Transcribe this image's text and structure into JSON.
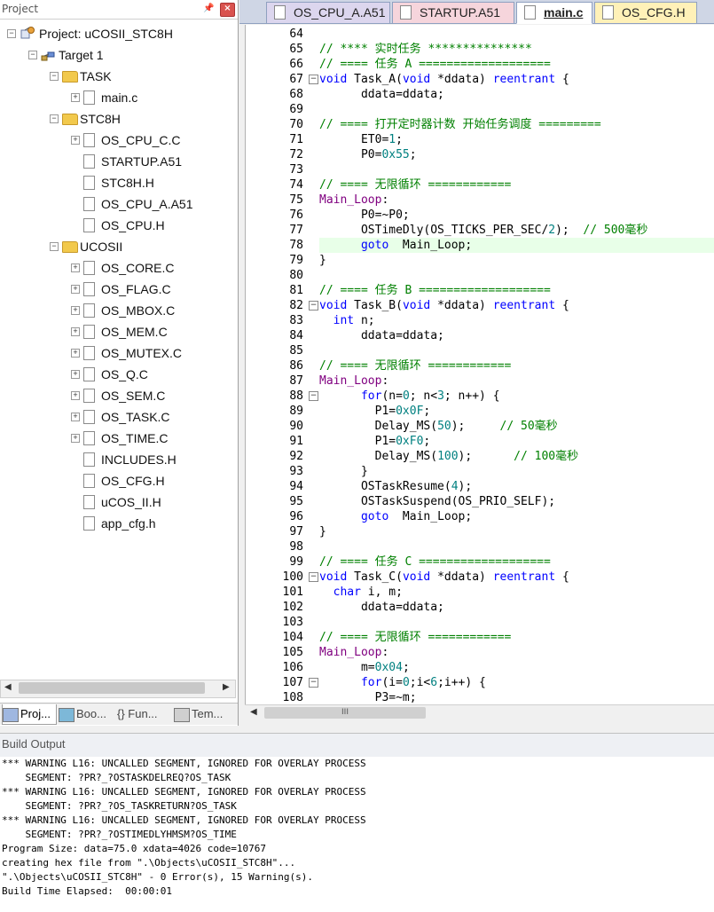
{
  "project_pane": {
    "title": "Project",
    "tree": [
      {
        "label": "Project: uCOSII_STC8H",
        "level": 0,
        "type": "project",
        "expander": "−"
      },
      {
        "label": "Target 1",
        "level": 1,
        "type": "target",
        "expander": "−"
      },
      {
        "label": "TASK",
        "level": 2,
        "type": "folder",
        "expander": "−"
      },
      {
        "label": "main.c",
        "level": 3,
        "type": "file",
        "expander": "+"
      },
      {
        "label": "STC8H",
        "level": 2,
        "type": "folder",
        "expander": "−"
      },
      {
        "label": "OS_CPU_C.C",
        "level": 3,
        "type": "file",
        "expander": "+"
      },
      {
        "label": "STARTUP.A51",
        "level": 3,
        "type": "file",
        "expander": ""
      },
      {
        "label": "STC8H.H",
        "level": 3,
        "type": "file",
        "expander": ""
      },
      {
        "label": "OS_CPU_A.A51",
        "level": 3,
        "type": "file",
        "expander": ""
      },
      {
        "label": "OS_CPU.H",
        "level": 3,
        "type": "file",
        "expander": ""
      },
      {
        "label": "UCOSII",
        "level": 2,
        "type": "folder",
        "expander": "−"
      },
      {
        "label": "OS_CORE.C",
        "level": 3,
        "type": "file",
        "expander": "+"
      },
      {
        "label": "OS_FLAG.C",
        "level": 3,
        "type": "file",
        "expander": "+"
      },
      {
        "label": "OS_MBOX.C",
        "level": 3,
        "type": "file",
        "expander": "+"
      },
      {
        "label": "OS_MEM.C",
        "level": 3,
        "type": "file",
        "expander": "+"
      },
      {
        "label": "OS_MUTEX.C",
        "level": 3,
        "type": "file",
        "expander": "+"
      },
      {
        "label": "OS_Q.C",
        "level": 3,
        "type": "file",
        "expander": "+"
      },
      {
        "label": "OS_SEM.C",
        "level": 3,
        "type": "file",
        "expander": "+"
      },
      {
        "label": "OS_TASK.C",
        "level": 3,
        "type": "file",
        "expander": "+"
      },
      {
        "label": "OS_TIME.C",
        "level": 3,
        "type": "file",
        "expander": "+"
      },
      {
        "label": "INCLUDES.H",
        "level": 3,
        "type": "file",
        "expander": ""
      },
      {
        "label": "OS_CFG.H",
        "level": 3,
        "type": "file",
        "expander": ""
      },
      {
        "label": "uCOS_II.H",
        "level": 3,
        "type": "file",
        "expander": ""
      },
      {
        "label": "app_cfg.h",
        "level": 3,
        "type": "file",
        "expander": ""
      }
    ],
    "tabs": [
      {
        "label": "Proj...",
        "active": true
      },
      {
        "label": "Boo...",
        "active": false
      },
      {
        "label": "{} Fun...",
        "active": false
      },
      {
        "label": "Tem...",
        "active": false
      }
    ]
  },
  "editor": {
    "tabs": [
      {
        "label": "OS_CPU_A.A51",
        "active": false,
        "color": "#dcd6ee"
      },
      {
        "label": "STARTUP.A51",
        "active": false,
        "color": "#f6d5dc"
      },
      {
        "label": "main.c",
        "active": true,
        "color": "#ffffff"
      },
      {
        "label": "OS_CFG.H",
        "active": false,
        "color": "#fff1b8"
      }
    ],
    "highlight_line": 78,
    "lines": [
      {
        "n": "64",
        "text": ""
      },
      {
        "n": "65",
        "text": "// **** 实时任务 ***************"
      },
      {
        "n": "66",
        "text": "// ==== 任务 A ==================="
      },
      {
        "n": "67",
        "text": "void Task_A(void *ddata) reentrant {",
        "fold": "−"
      },
      {
        "n": "68",
        "text": "      ddata=ddata;"
      },
      {
        "n": "69",
        "text": ""
      },
      {
        "n": "70",
        "text": "// ==== 打开定时器计数 开始任务调度 ========="
      },
      {
        "n": "71",
        "text": "      ET0=1;"
      },
      {
        "n": "72",
        "text": "      P0=0x55;"
      },
      {
        "n": "73",
        "text": ""
      },
      {
        "n": "74",
        "text": "// ==== 无限循环 ============"
      },
      {
        "n": "75",
        "text": "Main_Loop:"
      },
      {
        "n": "76",
        "text": "      P0=~P0;"
      },
      {
        "n": "77",
        "text": "      OSTimeDly(OS_TICKS_PER_SEC/2);  // 500毫秒"
      },
      {
        "n": "78",
        "text": "      goto  Main_Loop;"
      },
      {
        "n": "79",
        "text": "}"
      },
      {
        "n": "80",
        "text": ""
      },
      {
        "n": "81",
        "text": "// ==== 任务 B ==================="
      },
      {
        "n": "82",
        "text": "void Task_B(void *ddata) reentrant {",
        "fold": "−"
      },
      {
        "n": "83",
        "text": "  int n;"
      },
      {
        "n": "84",
        "text": "      ddata=ddata;"
      },
      {
        "n": "85",
        "text": ""
      },
      {
        "n": "86",
        "text": "// ==== 无限循环 ============"
      },
      {
        "n": "87",
        "text": "Main_Loop:"
      },
      {
        "n": "88",
        "text": "      for(n=0; n<3; n++) {",
        "fold": "−"
      },
      {
        "n": "89",
        "text": "        P1=0x0F;"
      },
      {
        "n": "90",
        "text": "        Delay_MS(50);     // 50毫秒"
      },
      {
        "n": "91",
        "text": "        P1=0xF0;"
      },
      {
        "n": "92",
        "text": "        Delay_MS(100);      // 100毫秒"
      },
      {
        "n": "93",
        "text": "      }"
      },
      {
        "n": "94",
        "text": "      OSTaskResume(4);"
      },
      {
        "n": "95",
        "text": "      OSTaskSuspend(OS_PRIO_SELF);"
      },
      {
        "n": "96",
        "text": "      goto  Main_Loop;"
      },
      {
        "n": "97",
        "text": "}"
      },
      {
        "n": "98",
        "text": ""
      },
      {
        "n": "99",
        "text": "// ==== 任务 C ==================="
      },
      {
        "n": "100",
        "text": "void Task_C(void *ddata) reentrant {",
        "fold": "−"
      },
      {
        "n": "101",
        "text": "  char i, m;"
      },
      {
        "n": "102",
        "text": "      ddata=ddata;"
      },
      {
        "n": "103",
        "text": ""
      },
      {
        "n": "104",
        "text": "// ==== 无限循环 ============"
      },
      {
        "n": "105",
        "text": "Main_Loop:"
      },
      {
        "n": "106",
        "text": "      m=0x04;"
      },
      {
        "n": "107",
        "text": "      for(i=0;i<6;i++) {",
        "fold": "−"
      },
      {
        "n": "108",
        "text": "        P3=~m;"
      }
    ],
    "hscroll_thumb": "III"
  },
  "build_output": {
    "title": "Build Output",
    "lines": [
      "*** WARNING L16: UNCALLED SEGMENT, IGNORED FOR OVERLAY PROCESS",
      "    SEGMENT: ?PR?_?OSTASKDELREQ?OS_TASK",
      "*** WARNING L16: UNCALLED SEGMENT, IGNORED FOR OVERLAY PROCESS",
      "    SEGMENT: ?PR?_?OS_TASKRETURN?OS_TASK",
      "*** WARNING L16: UNCALLED SEGMENT, IGNORED FOR OVERLAY PROCESS",
      "    SEGMENT: ?PR?_?OSTIMEDLYHMSM?OS_TIME",
      "Program Size: data=75.0 xdata=4026 code=10767",
      "creating hex file from \".\\Objects\\uCOSII_STC8H\"...",
      "\".\\Objects\\uCOSII_STC8H\" - 0 Error(s), 15 Warning(s).",
      "Build Time Elapsed:  00:00:01"
    ]
  },
  "colors": {
    "comment": "#008000",
    "keyword": "#0000ff",
    "number": "#008080",
    "label": "#800080",
    "highlight": "#e8ffe8"
  }
}
